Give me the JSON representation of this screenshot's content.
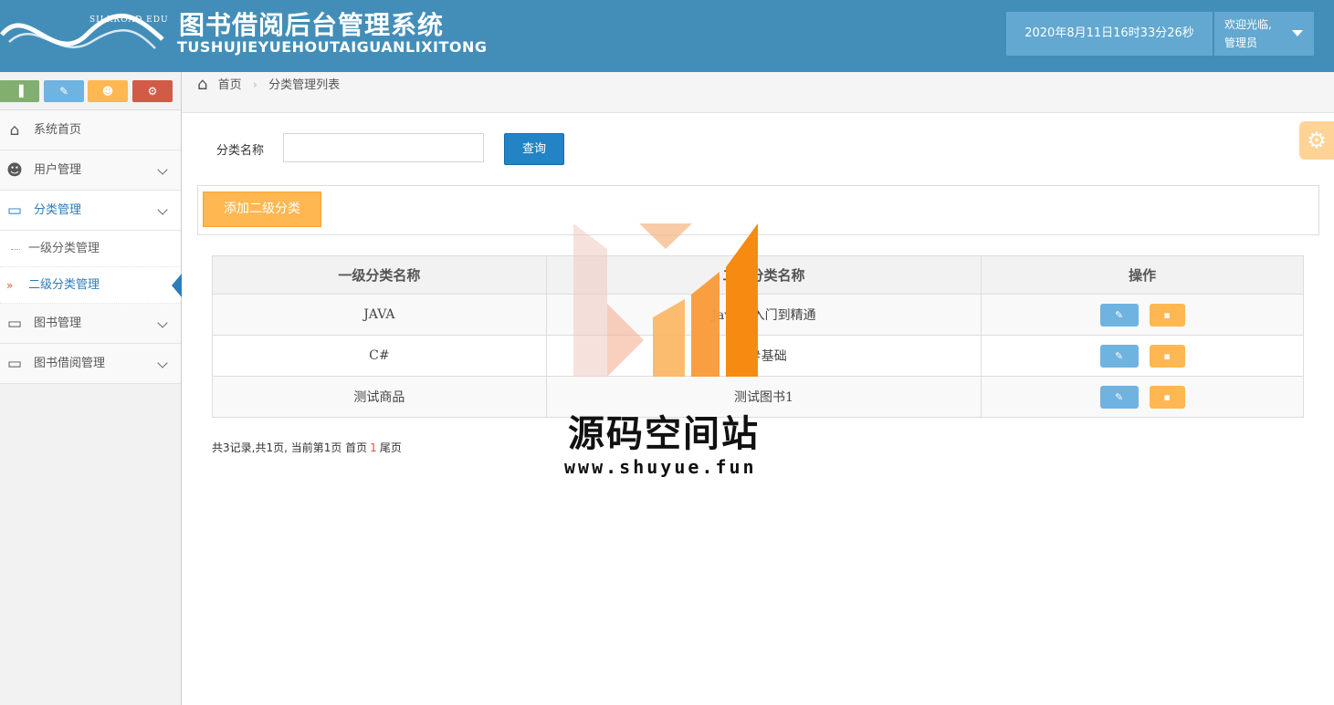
{
  "header": {
    "logo_text": "SILKROAD EDU",
    "title_cn": "图书借阅后台管理系统",
    "title_en": "TUSHUJIEYUEHOUTAIGUANLIXITONG",
    "datetime": "2020年8月11日16时33分26秒",
    "welcome": "欢迎光临,",
    "user_role": "管理员"
  },
  "shortcuts": {
    "stats": "▐",
    "edit": "✎",
    "users": "☻",
    "settings": "⚙"
  },
  "sidebar": {
    "items": [
      {
        "label": "系统首页"
      },
      {
        "label": "用户管理"
      },
      {
        "label": "分类管理"
      },
      {
        "label": "一级分类管理"
      },
      {
        "label": "二级分类管理"
      },
      {
        "label": "图书管理"
      },
      {
        "label": "图书借阅管理"
      }
    ]
  },
  "breadcrumb": {
    "home": "首页",
    "current": "分类管理列表"
  },
  "search": {
    "label": "分类名称",
    "value": "",
    "button": "查询"
  },
  "toolbar": {
    "add_label": "添加二级分类"
  },
  "table": {
    "headers": [
      "一级分类名称",
      "二级分类名称",
      "操作"
    ],
    "rows": [
      {
        "first": "JAVA",
        "second": "Java从入门到精通"
      },
      {
        "first": "C#",
        "second": "C#基础"
      },
      {
        "first": "测试商品",
        "second": "测试图书1"
      }
    ]
  },
  "pager": {
    "summary": "共3记录,共1页, 当前第1页 首页",
    "current": "1",
    "last": "尾页"
  },
  "watermark": {
    "name": "源码空间站",
    "url": "www.shuyue.fun"
  },
  "colors": {
    "header": "#438eb9",
    "accent": "#2b7dbc",
    "warning": "#ffb752",
    "info": "#6fb3e0"
  }
}
